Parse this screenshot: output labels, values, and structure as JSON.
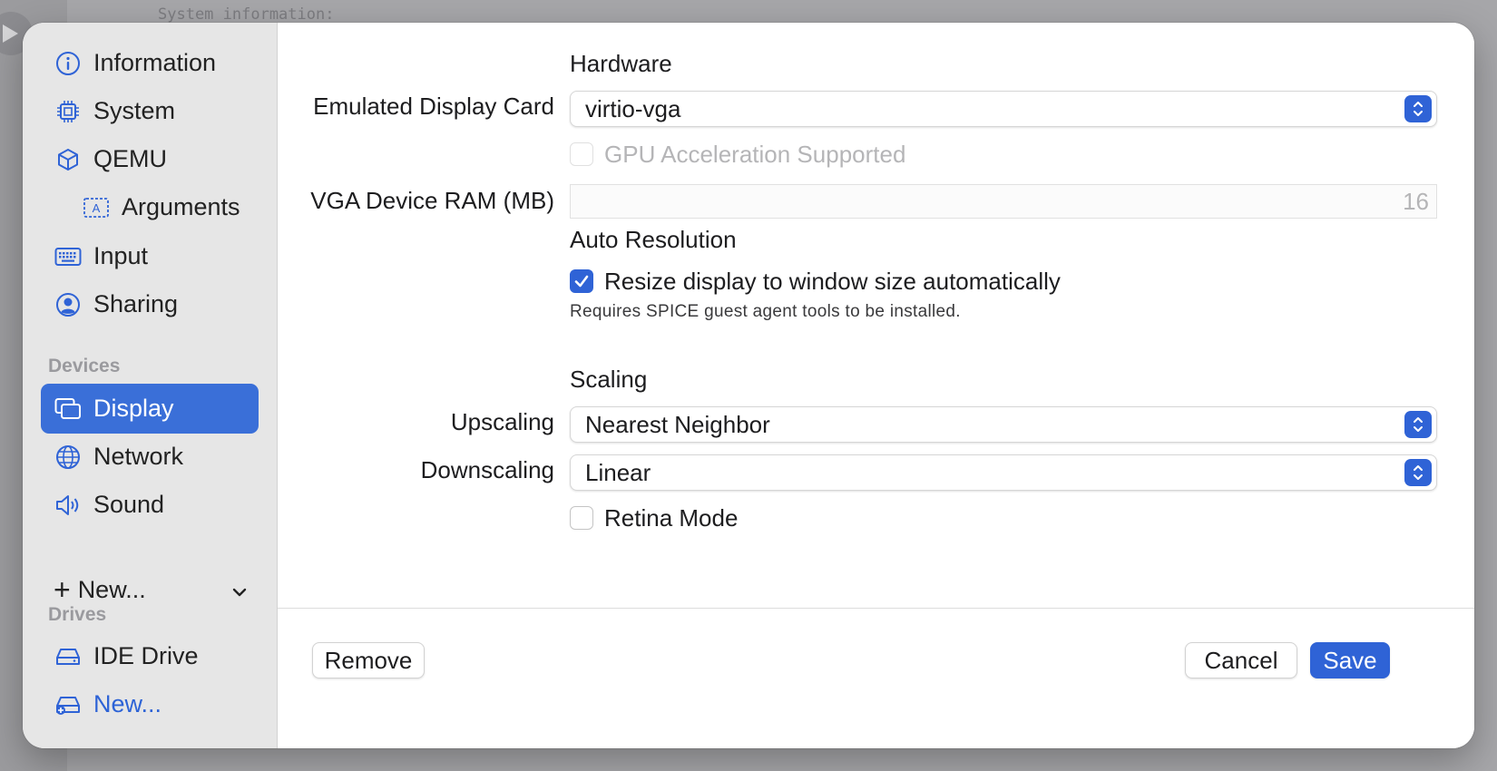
{
  "background": {
    "terminal_text": "System information:"
  },
  "sidebar": {
    "items": [
      {
        "label": "Information",
        "icon": "info-circle-icon"
      },
      {
        "label": "System",
        "icon": "cpu-chip-icon"
      },
      {
        "label": "QEMU",
        "icon": "cube-icon"
      },
      {
        "label": "Arguments",
        "icon": "text-field-icon"
      },
      {
        "label": "Input",
        "icon": "keyboard-icon"
      },
      {
        "label": "Sharing",
        "icon": "person-circle-icon"
      }
    ],
    "devices_header": "Devices",
    "devices": [
      {
        "label": "Display",
        "icon": "display-windows-icon",
        "selected": true
      },
      {
        "label": "Network",
        "icon": "globe-icon"
      },
      {
        "label": "Sound",
        "icon": "speaker-icon"
      }
    ],
    "new_device_label": "New...",
    "drives_header": "Drives",
    "drives": [
      {
        "label": "IDE Drive",
        "icon": "drive-icon"
      },
      {
        "label": "New...",
        "icon": "add-drive-icon"
      }
    ]
  },
  "form": {
    "hardware_title": "Hardware",
    "display_card_label": "Emulated Display Card",
    "display_card_value": "virtio-vga",
    "gpu_accel_label": "GPU Acceleration Supported",
    "vga_ram_label": "VGA Device RAM (MB)",
    "vga_ram_value": "16",
    "auto_resolution_title": "Auto Resolution",
    "resize_label": "Resize display to window size automatically",
    "resize_checked": true,
    "spice_note": "Requires SPICE guest agent tools to be installed.",
    "scaling_title": "Scaling",
    "upscaling_label": "Upscaling",
    "upscaling_value": "Nearest Neighbor",
    "downscaling_label": "Downscaling",
    "downscaling_value": "Linear",
    "retina_label": "Retina Mode",
    "retina_checked": false
  },
  "footer": {
    "remove_label": "Remove",
    "cancel_label": "Cancel",
    "save_label": "Save"
  },
  "colors": {
    "accent": "#2f63d6",
    "selected": "#3a6fd8",
    "sidebar_bg": "#e6e6e6"
  }
}
